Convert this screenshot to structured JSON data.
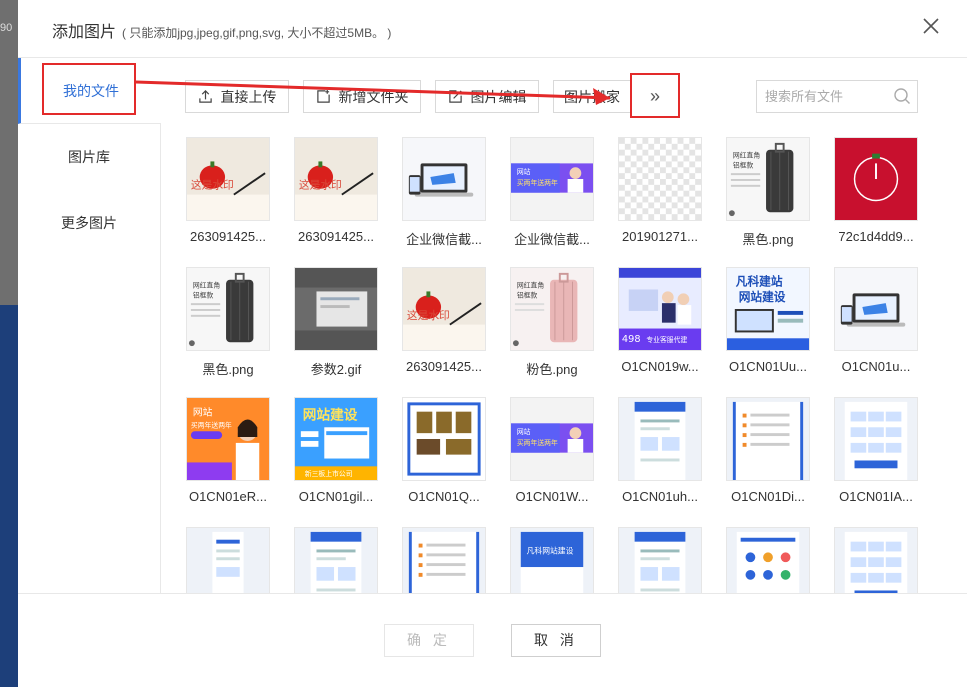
{
  "background": {
    "left_number": "90"
  },
  "dialog": {
    "title": "添加图片",
    "subtitle": "( 只能添加jpg,jpeg,gif,png,svg, 大小不超过5MB。 )"
  },
  "sidebar": {
    "items": [
      {
        "label": "我的文件",
        "active": true
      },
      {
        "label": "图片库",
        "active": false
      },
      {
        "label": "更多图片",
        "active": false
      }
    ]
  },
  "toolbar": {
    "upload_label": "直接上传",
    "new_folder_label": "新增文件夹",
    "edit_label": "图片编辑",
    "move_label": "图片搬家",
    "more_label": "»",
    "search_placeholder": "搜索所有文件"
  },
  "files": [
    {
      "name": "263091425...",
      "art": "tomato"
    },
    {
      "name": "263091425...",
      "art": "tomato"
    },
    {
      "name": "企业微信截...",
      "art": "laptop"
    },
    {
      "name": "企业微信截...",
      "art": "banner-girl"
    },
    {
      "name": "201901271...",
      "art": "transparent"
    },
    {
      "name": "黑色.png",
      "art": "suitcase-black"
    },
    {
      "name": "72c1d4dd9...",
      "art": "red-clock"
    },
    {
      "name": "黑色.png",
      "art": "suitcase-black"
    },
    {
      "name": "参数2.gif",
      "art": "screen"
    },
    {
      "name": "263091425...",
      "art": "tomato"
    },
    {
      "name": "粉色.png",
      "art": "suitcase-pink"
    },
    {
      "name": "O1CN019w...",
      "art": "service"
    },
    {
      "name": "O1CN01Uu...",
      "art": "fanke"
    },
    {
      "name": "O1CN01u...",
      "art": "laptop"
    },
    {
      "name": "O1CN01eR...",
      "art": "girl-orange"
    },
    {
      "name": "O1CN01gil...",
      "art": "wangzhan"
    },
    {
      "name": "O1CN01Q...",
      "art": "certificates"
    },
    {
      "name": "O1CN01W...",
      "art": "banner-girl"
    },
    {
      "name": "O1CN01uh...",
      "art": "doc-blue"
    },
    {
      "name": "O1CN01Di...",
      "art": "doc-list"
    },
    {
      "name": "O1CN01IA...",
      "art": "doc-grid"
    },
    {
      "name": "",
      "art": "doc-phone"
    },
    {
      "name": "",
      "art": "doc-blue"
    },
    {
      "name": "",
      "art": "doc-list"
    },
    {
      "name": "",
      "art": "doc-banner"
    },
    {
      "name": "",
      "art": "doc-blue"
    },
    {
      "name": "",
      "art": "doc-icons"
    },
    {
      "name": "",
      "art": "doc-grid"
    }
  ],
  "footer": {
    "ok_label": "确 定",
    "cancel_label": "取 消"
  },
  "colors": {
    "accent": "#2f6fd6",
    "highlight": "#e32a2a",
    "nav_bg": "#1d3f7a"
  },
  "thumb_text": {
    "tomato": "这是水印",
    "banner_line1": "网站",
    "banner_line2": "买两年送两年",
    "suitcase_line1": "网红直角",
    "suitcase_line2": "铝框款",
    "service_tag": "专业客服代建",
    "service_price": "498",
    "fanke_line1": "凡科建站",
    "fanke_line2": "网站建设",
    "wangzhan_title": "网站建设",
    "wangzhan_sub": "新三板上市公司",
    "girl_line1": "网站",
    "girl_line2": "买两年送两年",
    "doc_banner": "凡科网站建设"
  }
}
